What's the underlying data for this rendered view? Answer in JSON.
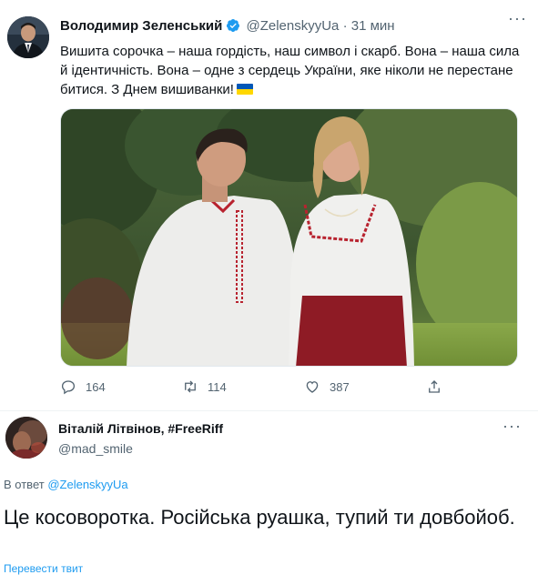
{
  "tweet": {
    "author_name": "Володимир Зеленський",
    "handle": "@ZelenskyyUa",
    "separator": "·",
    "time": "31 мин",
    "more": "···",
    "text": "Вишита сорочка – наша гордість, наш символ і скарб. Вона – наша сила й ідентичність. Вона – одне з сердець України, яке ніколи не перестане битися. З Днем вишиванки!",
    "flag_emoji": "ukraine-flag-icon",
    "stats": {
      "replies": "164",
      "retweets": "114",
      "likes": "387"
    }
  },
  "reply_tweet": {
    "author_name": "Віталій Літвінов, #FreeRiff",
    "handle": "@mad_smile",
    "more": "···",
    "in_reply_prefix": "В ответ",
    "in_reply_handle": "@ZelenskyyUa",
    "text": "Це косоворотка. Російська руашка, тупий ти довбойоб.",
    "translate_label": "Перевести твит"
  },
  "colors": {
    "accent": "#1d9bf0",
    "secondary_text": "#536471",
    "primary_text": "#0f1419",
    "divider": "#eff3f4",
    "embroidery_red": "#b8232f"
  }
}
